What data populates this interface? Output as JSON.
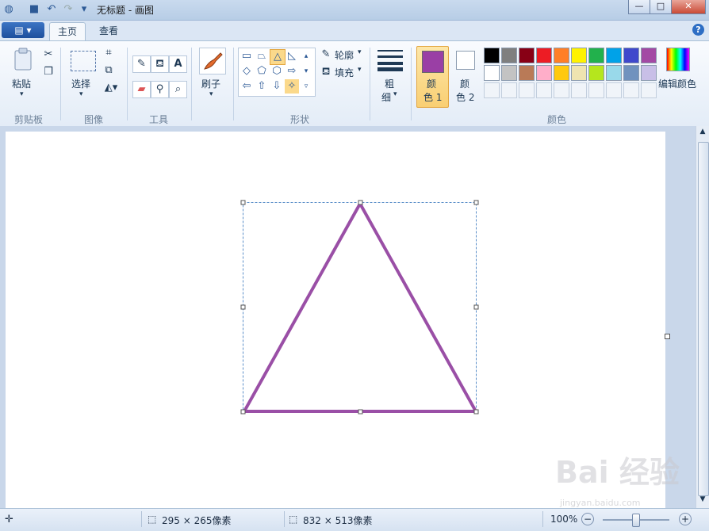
{
  "window": {
    "title": "无标题 - 画图",
    "minimize": "—",
    "maximize": "□",
    "close": "✕"
  },
  "tabs": {
    "home": "主页",
    "view": "查看",
    "help": "?"
  },
  "groups": {
    "clipboard": "剪贴板",
    "image": "图像",
    "tools": "工具",
    "shapes": "形状",
    "colors": "颜色"
  },
  "buttons": {
    "paste": "粘贴",
    "select": "选择",
    "brushes": "刷子",
    "outline": "轮廓",
    "fill": "填充",
    "size_line1": "粗",
    "size_line2": "细",
    "color1_line1": "颜",
    "color1_line2": "色 1",
    "color2_line1": "颜",
    "color2_line2": "色 2",
    "edit_colors": "编辑颜色"
  },
  "colors": {
    "color1": "#9a3fa5",
    "color2": "#ffffff",
    "palette_row1": [
      "#000000",
      "#7f7f7f",
      "#880015",
      "#ed1c24",
      "#ff7f27",
      "#fff200",
      "#22b14c",
      "#00a2e8",
      "#3f48cc",
      "#a349a4"
    ],
    "palette_row2": [
      "#ffffff",
      "#c3c3c3",
      "#b97a57",
      "#ffaec9",
      "#ffc90e",
      "#efe4b0",
      "#b5e61d",
      "#99d9ea",
      "#7092be",
      "#c8bfe7"
    ]
  },
  "status": {
    "selection_size": "295 × 265像素",
    "image_size": "832 × 513像素",
    "zoom": "100%"
  },
  "watermark": {
    "main": "Bai 经验",
    "sub": "jingyan.baidu.com"
  }
}
